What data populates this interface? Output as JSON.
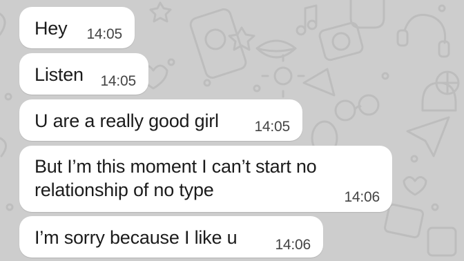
{
  "chat": {
    "colors": {
      "wallpaper": "#cdcdcd",
      "bubble": "#ffffff",
      "text": "#1b1b1b",
      "time": "#444444"
    },
    "messages": [
      {
        "text": "Hey",
        "time": "14:05"
      },
      {
        "text": "Listen",
        "time": "14:05"
      },
      {
        "text": "U are a really good girl",
        "time": "14:05"
      },
      {
        "text": "But I’m this moment I can’t start no relationship of no type",
        "time": "14:06"
      },
      {
        "text": "I’m sorry because I like u",
        "time": "14:06"
      }
    ]
  }
}
